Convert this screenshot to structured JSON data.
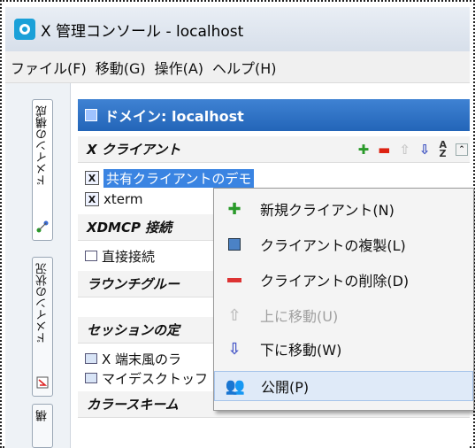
{
  "window": {
    "title": "X 管理コンソール - localhost"
  },
  "menubar": [
    "ファイル(F)",
    "移動(G)",
    "操作(A)",
    "ヘルプ(H)"
  ],
  "sidebar": {
    "tabs": [
      {
        "label": "ドメインの構成",
        "icon": "network-icon"
      },
      {
        "label": "ドメインの状況",
        "icon": "status-icon"
      },
      {
        "label": "構",
        "icon": "tab3-icon"
      }
    ]
  },
  "domain": {
    "header": "ドメイン: localhost"
  },
  "sections": {
    "xclients": {
      "title": "X クライアント"
    },
    "xdmcp": {
      "title": "XDMCP 接続"
    },
    "launch": {
      "title": "ラウンチグルー"
    },
    "session": {
      "title": "セッションの定"
    },
    "colors": {
      "title": "カラースキーム"
    }
  },
  "items": {
    "shared_client": "共有クライアントのデモ",
    "xterm": "xterm",
    "direct": "直接接続",
    "session1": "X 端末風のラ",
    "session2": "マイデスクトッフ"
  },
  "context_menu": {
    "items": [
      {
        "label": "新規クライアント(N)",
        "icon": "add-icon",
        "enabled": true
      },
      {
        "label": "クライアントの複製(L)",
        "icon": "copy-icon",
        "enabled": true
      },
      {
        "label": "クライアントの削除(D)",
        "icon": "delete-icon",
        "enabled": true
      },
      {
        "label": "上に移動(U)",
        "icon": "move-up-icon",
        "enabled": false
      },
      {
        "label": "下に移動(W)",
        "icon": "move-down-icon",
        "enabled": true
      },
      {
        "label": "公開(P)",
        "icon": "publish-icon",
        "enabled": true,
        "highlighted": true
      }
    ]
  },
  "toolbar_icons": [
    "add-icon",
    "remove-icon",
    "move-up-icon",
    "move-down-icon",
    "sort-az-icon",
    "collapse-icon"
  ]
}
